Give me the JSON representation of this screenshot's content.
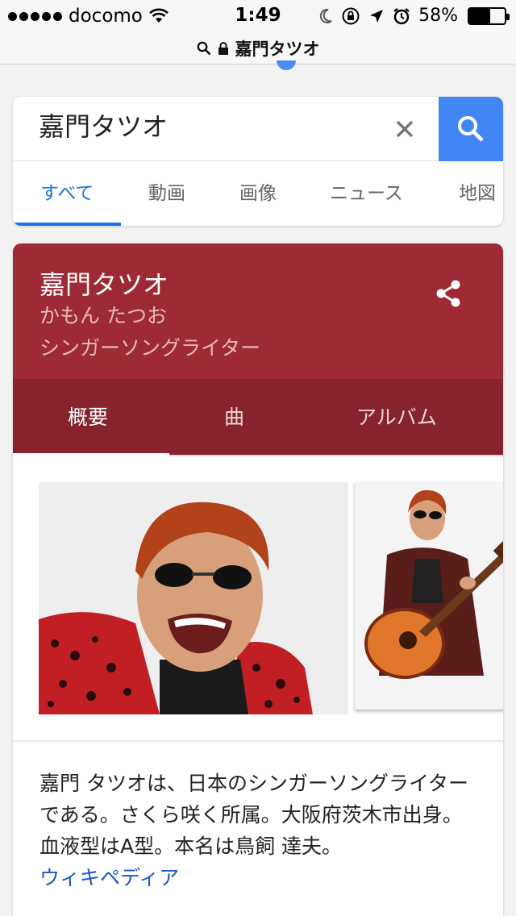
{
  "status_bar": {
    "carrier": "docomo",
    "time": "1:49",
    "battery": "58%",
    "battery_level": 0.58,
    "icons": [
      "signal-dots-icon",
      "wifi-icon",
      "moon-icon",
      "rotation-lock-icon",
      "location-arrow-icon",
      "alarm-icon",
      "battery-icon"
    ]
  },
  "url_bar": {
    "text": "嘉門タツオ",
    "icons": [
      "search-icon",
      "lock-icon"
    ]
  },
  "search": {
    "query": "嘉門タツオ",
    "clear_icon": "close-icon",
    "button_icon": "search-icon",
    "accent_color": "#4285f4"
  },
  "tabs": [
    {
      "label": "すべて",
      "active": true
    },
    {
      "label": "動画",
      "active": false
    },
    {
      "label": "画像",
      "active": false
    },
    {
      "label": "ニュース",
      "active": false
    },
    {
      "label": "地図",
      "active": false
    }
  ],
  "knowledge_panel": {
    "title": "嘉門タツオ",
    "reading": "かもん たつお",
    "description": "シンガーソングライター",
    "header_color": "#9e2a36",
    "tab_bar_color": "#86232c",
    "share_icon": "share-icon",
    "tabs": [
      {
        "label": "概要",
        "active": true
      },
      {
        "label": "曲",
        "active": false
      },
      {
        "label": "アルバム",
        "active": false
      }
    ],
    "summary": "嘉門 タツオは、日本のシンガーソングライターである。さくら咲く所属。大阪府茨木市出身。血液型はA型。本名は鳥飼 達夫。",
    "source_link": "ウィキペディア"
  }
}
